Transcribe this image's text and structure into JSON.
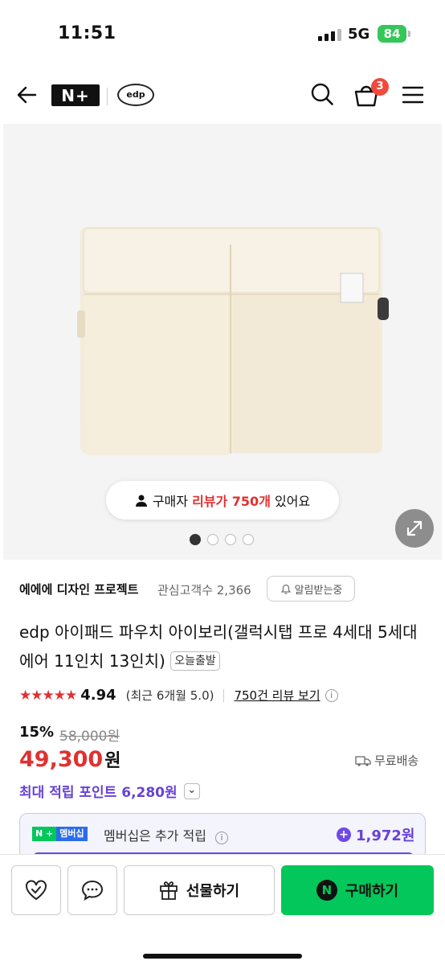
{
  "status": {
    "time": "11:51",
    "network": "5G",
    "battery": "84"
  },
  "header": {
    "logo": "N+",
    "brand_logo": "edp",
    "cart_count": "3"
  },
  "hero": {
    "review_prefix": "구매자 ",
    "review_highlight": "리뷰가 750개",
    "review_suffix": " 있어요",
    "dots_total": 4,
    "dots_active": 1
  },
  "store": {
    "name": "에에에 디자인 프로젝트",
    "followers": "관심고객수 2,366",
    "alarm_label": "알림받는중"
  },
  "product": {
    "title": "edp 아이패드 파우치 아이보리(갤럭시탭 프로 4세대 5세대 에어 11인치 13인치)",
    "tag": "오늘출발",
    "rating": "4.94",
    "recent_rating": "(최근 6개월 5.0)",
    "reviews_link": "750건 리뷰 보기",
    "discount": "15%",
    "original_price": "58,000원",
    "price": "49,300",
    "price_unit": "원",
    "shipping": "무료배송",
    "points": "최대 적립 포인트 6,280원"
  },
  "membership": {
    "badge_a": "N +",
    "badge_b": "멤버십",
    "text": "멤버십은 추가 적립",
    "value": "1,972원"
  },
  "bottom": {
    "gift_label": "선물하기",
    "buy_label": "구매하기",
    "buy_logo": "N"
  },
  "colors": {
    "accent_red": "#e03131",
    "purple": "#6741d9",
    "naver_green": "#03c75a"
  }
}
